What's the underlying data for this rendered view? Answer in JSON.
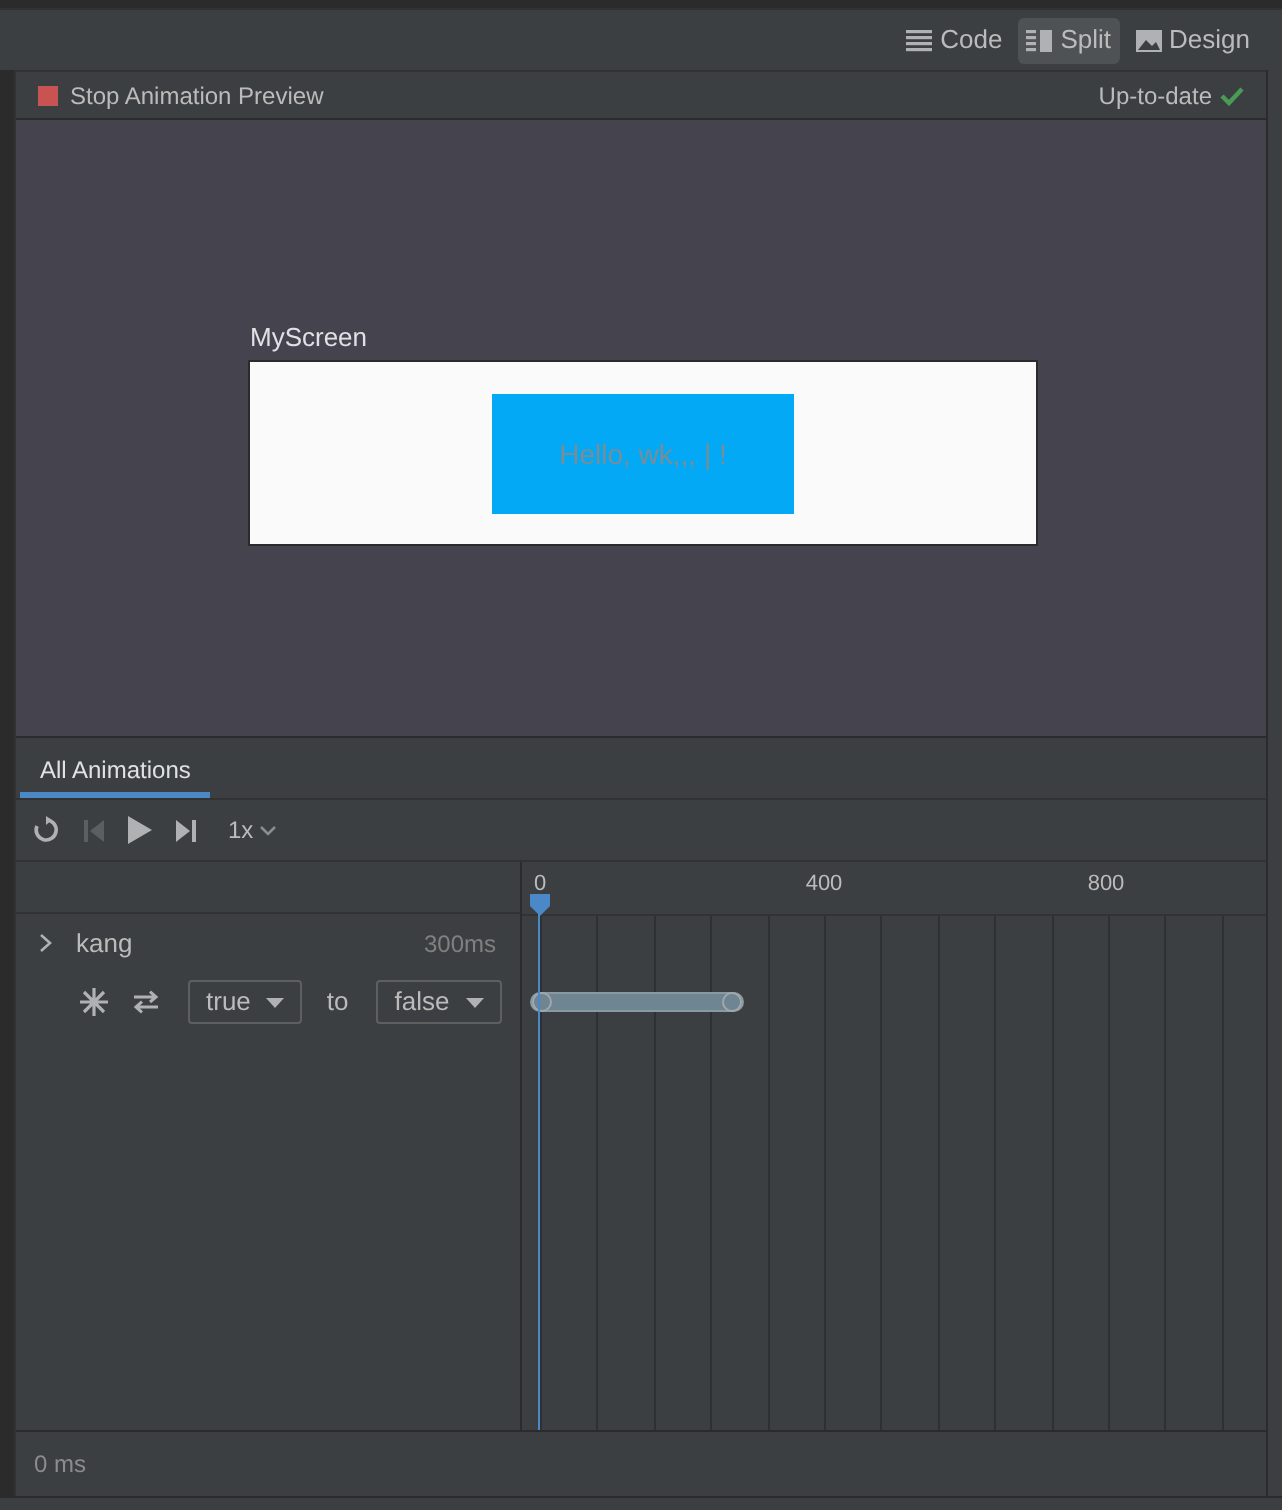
{
  "view_modes": [
    {
      "label": "Code",
      "kind": "code",
      "selected": false
    },
    {
      "label": "Split",
      "kind": "split",
      "selected": true
    },
    {
      "label": "Design",
      "kind": "design",
      "selected": false
    }
  ],
  "preview_header": {
    "stop_label": "Stop Animation Preview",
    "status": "Up-to-date"
  },
  "preview": {
    "screen_title": "MyScreen",
    "content_text": "Hello, wk,,, | !"
  },
  "tabs": [
    {
      "label": "All Animations",
      "selected": true
    }
  ],
  "controls": {
    "speed": "1x"
  },
  "timeline": {
    "ticks": [
      {
        "label": "0"
      },
      {
        "label": "400"
      },
      {
        "label": "800"
      }
    ],
    "animations": [
      {
        "name": "kang",
        "duration": "300ms",
        "expanded": false,
        "from": "true",
        "to_label": "to",
        "to": "false"
      }
    ]
  },
  "status_bar": {
    "time": "0 ms"
  }
}
